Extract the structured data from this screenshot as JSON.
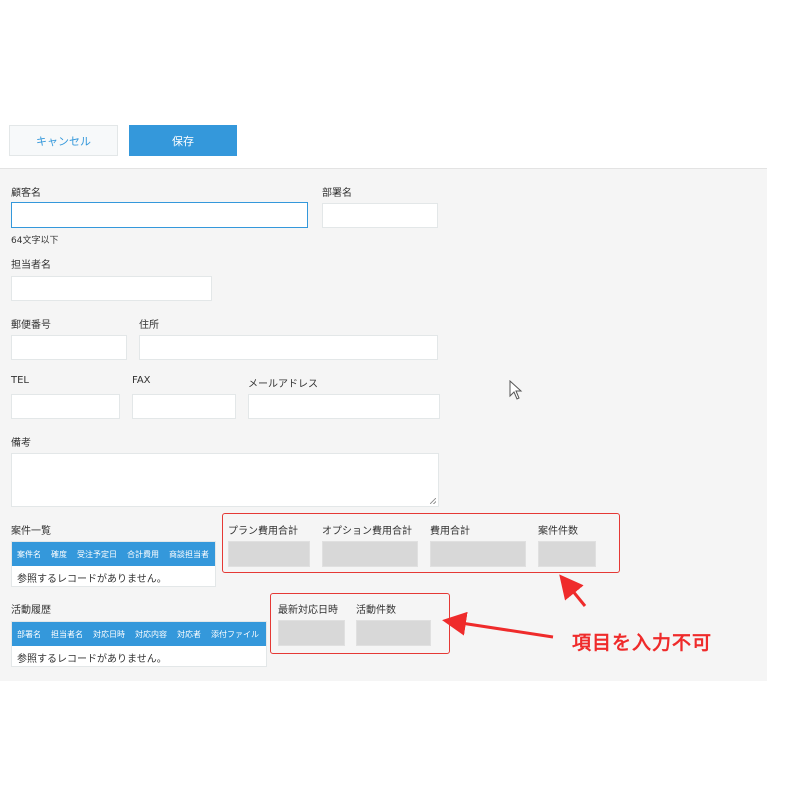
{
  "toolbar": {
    "cancel_label": "キャンセル",
    "save_label": "保存"
  },
  "form": {
    "customer_name": {
      "label": "顧客名",
      "value": "",
      "hint": "64文字以下"
    },
    "department": {
      "label": "部署名",
      "value": ""
    },
    "contact_person": {
      "label": "担当者名",
      "value": ""
    },
    "postal_code": {
      "label": "郵便番号",
      "value": ""
    },
    "address": {
      "label": "住所",
      "value": ""
    },
    "tel": {
      "label": "TEL",
      "value": ""
    },
    "fax": {
      "label": "FAX",
      "value": ""
    },
    "email": {
      "label": "メールアドレス",
      "value": ""
    },
    "remarks": {
      "label": "備考",
      "value": ""
    }
  },
  "cases": {
    "label": "案件一覧",
    "columns": [
      "案件名",
      "確度",
      "受注予定日",
      "合計費用",
      "商談担当者"
    ],
    "empty_text": "参照するレコードがありません。",
    "summary": {
      "plan_total": "プラン費用合計",
      "option_total": "オプション費用合計",
      "cost_total": "費用合計",
      "case_count": "案件件数"
    }
  },
  "activities": {
    "label": "活動履歴",
    "columns": [
      "部署名",
      "担当者名",
      "対応日時",
      "対応内容",
      "対応者",
      "添付ファイル"
    ],
    "empty_text": "参照するレコードがありません。",
    "summary": {
      "latest_datetime": "最新対応日時",
      "activity_count": "活動件数"
    }
  },
  "annotation": {
    "text": "項目を入力不可"
  },
  "colors": {
    "primary": "#3498db",
    "annotation_red": "#ef2b2b",
    "panel_bg": "#f5f5f5",
    "readonly_bg": "#d8d8d8"
  },
  "icons": {
    "cursor": "mouse-pointer-icon"
  }
}
